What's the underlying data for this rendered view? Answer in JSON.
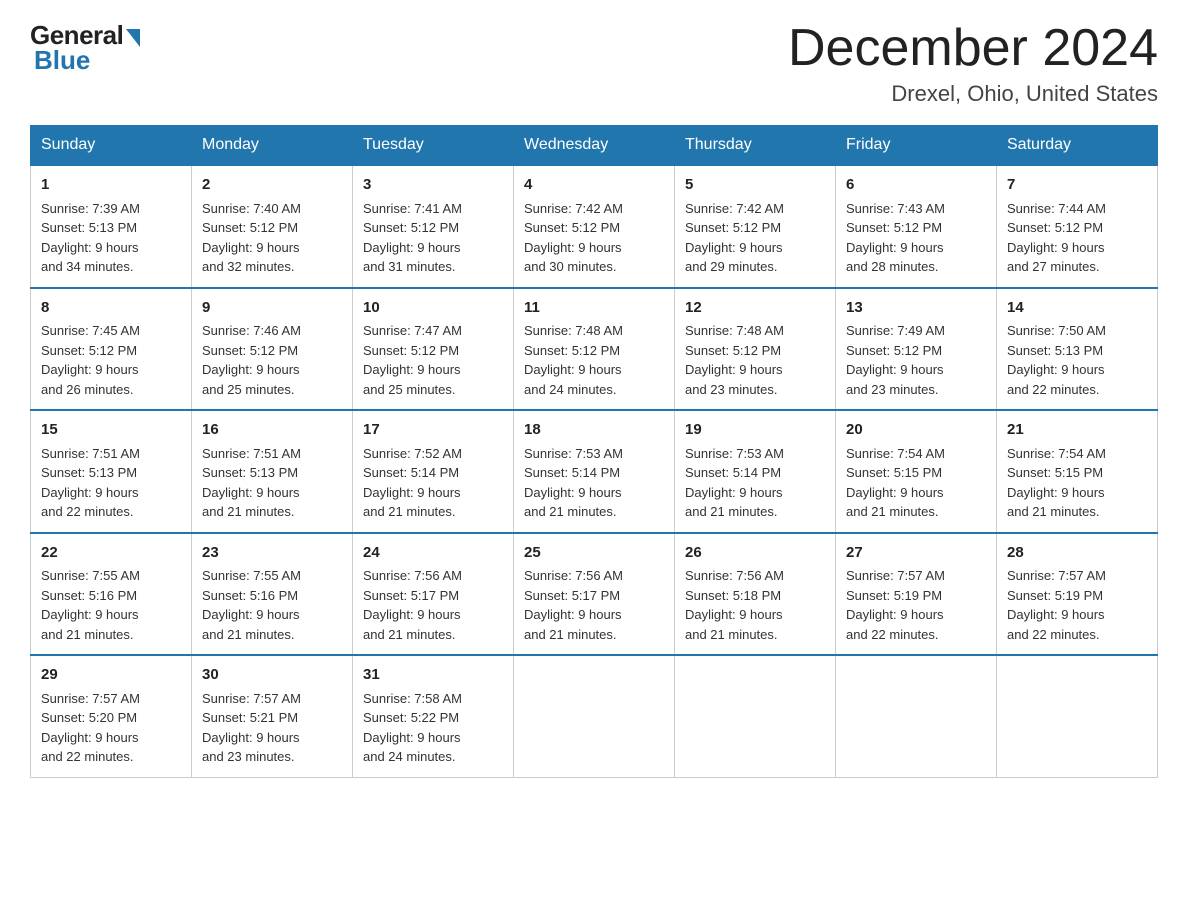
{
  "header": {
    "logo_general": "General",
    "logo_blue": "Blue",
    "month_title": "December 2024",
    "location": "Drexel, Ohio, United States"
  },
  "days_of_week": [
    "Sunday",
    "Monday",
    "Tuesday",
    "Wednesday",
    "Thursday",
    "Friday",
    "Saturday"
  ],
  "weeks": [
    [
      {
        "day": "1",
        "sunrise": "7:39 AM",
        "sunset": "5:13 PM",
        "daylight": "9 hours and 34 minutes."
      },
      {
        "day": "2",
        "sunrise": "7:40 AM",
        "sunset": "5:12 PM",
        "daylight": "9 hours and 32 minutes."
      },
      {
        "day": "3",
        "sunrise": "7:41 AM",
        "sunset": "5:12 PM",
        "daylight": "9 hours and 31 minutes."
      },
      {
        "day": "4",
        "sunrise": "7:42 AM",
        "sunset": "5:12 PM",
        "daylight": "9 hours and 30 minutes."
      },
      {
        "day": "5",
        "sunrise": "7:42 AM",
        "sunset": "5:12 PM",
        "daylight": "9 hours and 29 minutes."
      },
      {
        "day": "6",
        "sunrise": "7:43 AM",
        "sunset": "5:12 PM",
        "daylight": "9 hours and 28 minutes."
      },
      {
        "day": "7",
        "sunrise": "7:44 AM",
        "sunset": "5:12 PM",
        "daylight": "9 hours and 27 minutes."
      }
    ],
    [
      {
        "day": "8",
        "sunrise": "7:45 AM",
        "sunset": "5:12 PM",
        "daylight": "9 hours and 26 minutes."
      },
      {
        "day": "9",
        "sunrise": "7:46 AM",
        "sunset": "5:12 PM",
        "daylight": "9 hours and 25 minutes."
      },
      {
        "day": "10",
        "sunrise": "7:47 AM",
        "sunset": "5:12 PM",
        "daylight": "9 hours and 25 minutes."
      },
      {
        "day": "11",
        "sunrise": "7:48 AM",
        "sunset": "5:12 PM",
        "daylight": "9 hours and 24 minutes."
      },
      {
        "day": "12",
        "sunrise": "7:48 AM",
        "sunset": "5:12 PM",
        "daylight": "9 hours and 23 minutes."
      },
      {
        "day": "13",
        "sunrise": "7:49 AM",
        "sunset": "5:12 PM",
        "daylight": "9 hours and 23 minutes."
      },
      {
        "day": "14",
        "sunrise": "7:50 AM",
        "sunset": "5:13 PM",
        "daylight": "9 hours and 22 minutes."
      }
    ],
    [
      {
        "day": "15",
        "sunrise": "7:51 AM",
        "sunset": "5:13 PM",
        "daylight": "9 hours and 22 minutes."
      },
      {
        "day": "16",
        "sunrise": "7:51 AM",
        "sunset": "5:13 PM",
        "daylight": "9 hours and 21 minutes."
      },
      {
        "day": "17",
        "sunrise": "7:52 AM",
        "sunset": "5:14 PM",
        "daylight": "9 hours and 21 minutes."
      },
      {
        "day": "18",
        "sunrise": "7:53 AM",
        "sunset": "5:14 PM",
        "daylight": "9 hours and 21 minutes."
      },
      {
        "day": "19",
        "sunrise": "7:53 AM",
        "sunset": "5:14 PM",
        "daylight": "9 hours and 21 minutes."
      },
      {
        "day": "20",
        "sunrise": "7:54 AM",
        "sunset": "5:15 PM",
        "daylight": "9 hours and 21 minutes."
      },
      {
        "day": "21",
        "sunrise": "7:54 AM",
        "sunset": "5:15 PM",
        "daylight": "9 hours and 21 minutes."
      }
    ],
    [
      {
        "day": "22",
        "sunrise": "7:55 AM",
        "sunset": "5:16 PM",
        "daylight": "9 hours and 21 minutes."
      },
      {
        "day": "23",
        "sunrise": "7:55 AM",
        "sunset": "5:16 PM",
        "daylight": "9 hours and 21 minutes."
      },
      {
        "day": "24",
        "sunrise": "7:56 AM",
        "sunset": "5:17 PM",
        "daylight": "9 hours and 21 minutes."
      },
      {
        "day": "25",
        "sunrise": "7:56 AM",
        "sunset": "5:17 PM",
        "daylight": "9 hours and 21 minutes."
      },
      {
        "day": "26",
        "sunrise": "7:56 AM",
        "sunset": "5:18 PM",
        "daylight": "9 hours and 21 minutes."
      },
      {
        "day": "27",
        "sunrise": "7:57 AM",
        "sunset": "5:19 PM",
        "daylight": "9 hours and 22 minutes."
      },
      {
        "day": "28",
        "sunrise": "7:57 AM",
        "sunset": "5:19 PM",
        "daylight": "9 hours and 22 minutes."
      }
    ],
    [
      {
        "day": "29",
        "sunrise": "7:57 AM",
        "sunset": "5:20 PM",
        "daylight": "9 hours and 22 minutes."
      },
      {
        "day": "30",
        "sunrise": "7:57 AM",
        "sunset": "5:21 PM",
        "daylight": "9 hours and 23 minutes."
      },
      {
        "day": "31",
        "sunrise": "7:58 AM",
        "sunset": "5:22 PM",
        "daylight": "9 hours and 24 minutes."
      },
      null,
      null,
      null,
      null
    ]
  ],
  "labels": {
    "sunrise": "Sunrise:",
    "sunset": "Sunset:",
    "daylight": "Daylight:"
  }
}
